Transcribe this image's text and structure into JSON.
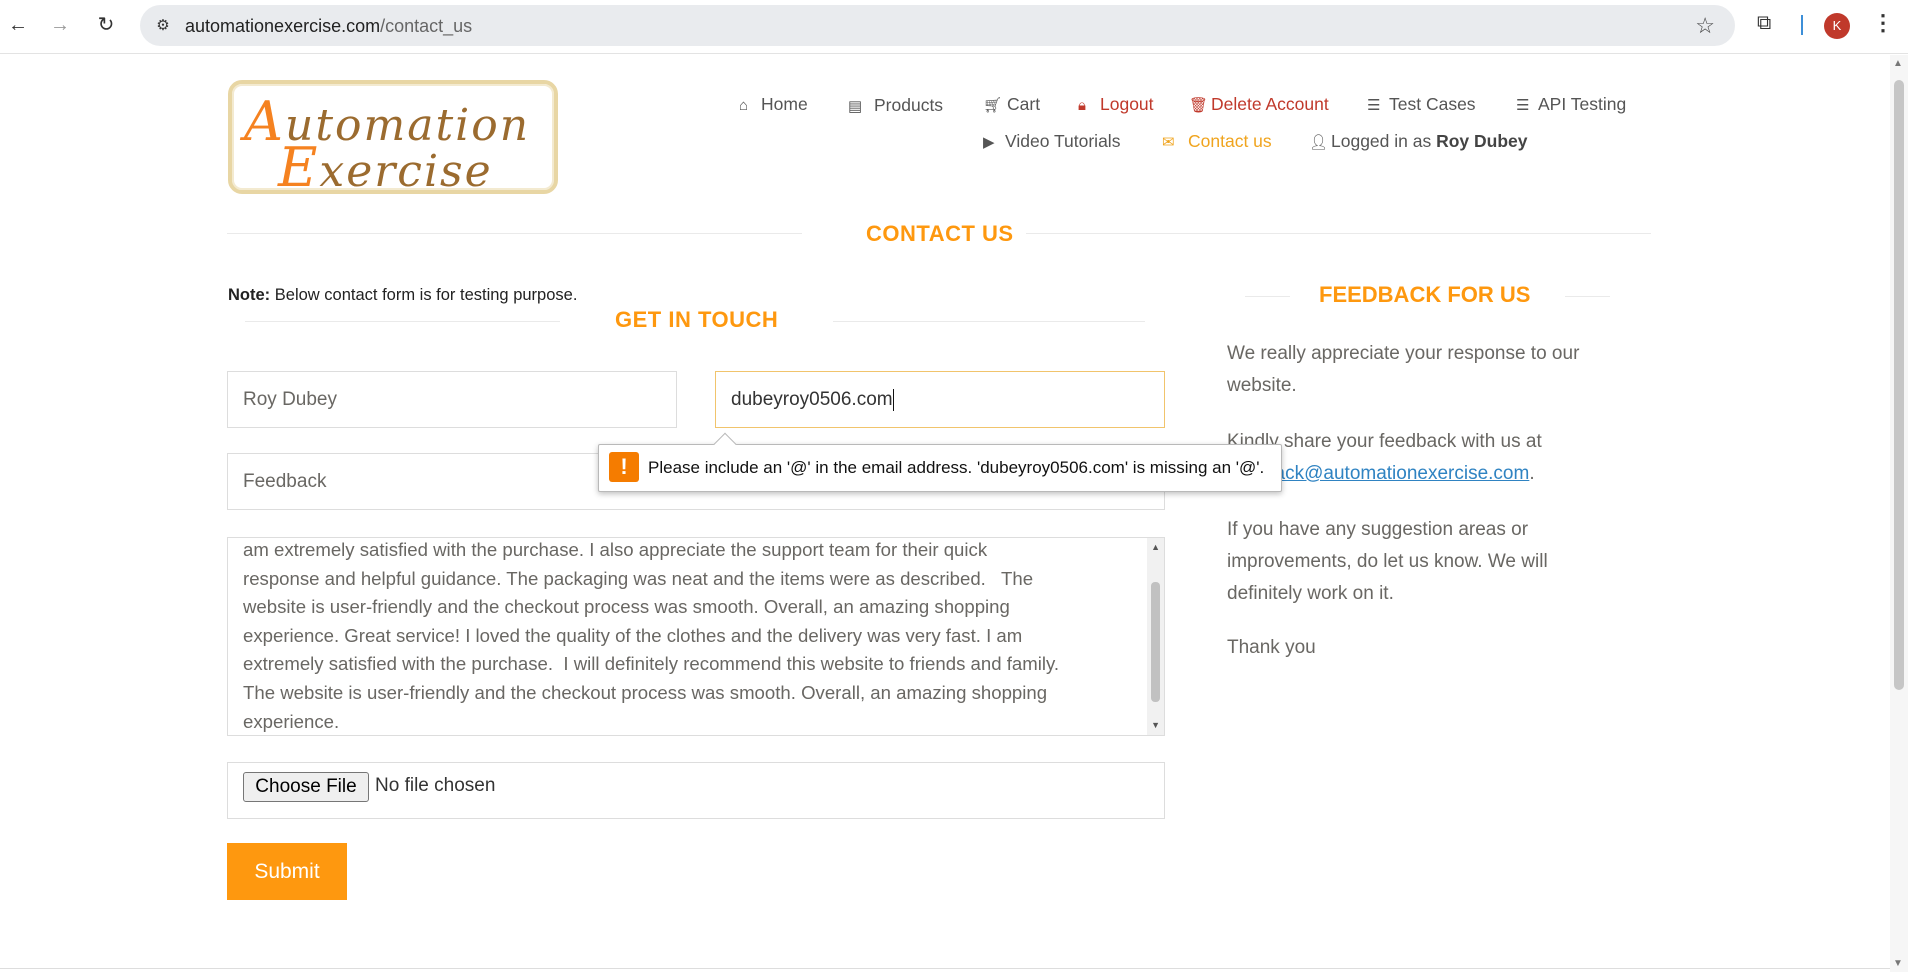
{
  "browser": {
    "url_host": "automationexercise.com",
    "url_path": "/contact_us",
    "avatar_letter": "K"
  },
  "nav": {
    "home": "Home",
    "products": "Products",
    "cart": "Cart",
    "logout": "Logout",
    "delete_account": "Delete Account",
    "test_cases": "Test Cases",
    "api_testing": "API Testing",
    "video_tutorials": "Video Tutorials",
    "contact_us": "Contact us",
    "logged_in_prefix": "Logged in as",
    "logged_in_user": "Roy Dubey"
  },
  "logo": {
    "line1": "Automation",
    "line2": "Exercise"
  },
  "page_title": "CONTACT US",
  "note": {
    "label": "Note:",
    "text": "Below contact form is for testing purpose."
  },
  "form": {
    "title": "GET IN TOUCH",
    "name_value": "Roy Dubey",
    "email_value": "dubeyroy0506.com",
    "subject_value": "Feedback",
    "message_value": "am extremely satisfied with the purchase. I also appreciate the support team for their quick\nresponse and helpful guidance. The packaging was neat and the items were as described.   The\nwebsite is user-friendly and the checkout process was smooth. Overall, an amazing shopping\nexperience. Great service! I loved the quality of the clothes and the delivery was very fast. I am\nextremely satisfied with the purchase.  I will definitely recommend this website to friends and family.\nThe website is user-friendly and the checkout process was smooth. Overall, an amazing shopping\nexperience.",
    "file_button": "Choose File",
    "file_status": "No file chosen",
    "submit_label": "Submit"
  },
  "validation_tooltip": {
    "icon": "!",
    "message": "Please include an '@' in the email address. 'dubeyroy0506.com' is missing an '@'."
  },
  "feedback": {
    "title": "FEEDBACK FOR US",
    "p1": "We really appreciate your response to our website.",
    "p2_prefix": "Kindly share your feedback with us at",
    "p2_link": "feedback@automationexercise.com",
    "p2_suffix": ".",
    "p3": "If you have any suggestion areas or improvements, do let us know. We will definitely work on it.",
    "p4": "Thank you"
  },
  "colors": {
    "accent": "#fe980f",
    "active_nav": "#f0a41e",
    "danger": "#c0392b",
    "link": "#2f83c2"
  }
}
